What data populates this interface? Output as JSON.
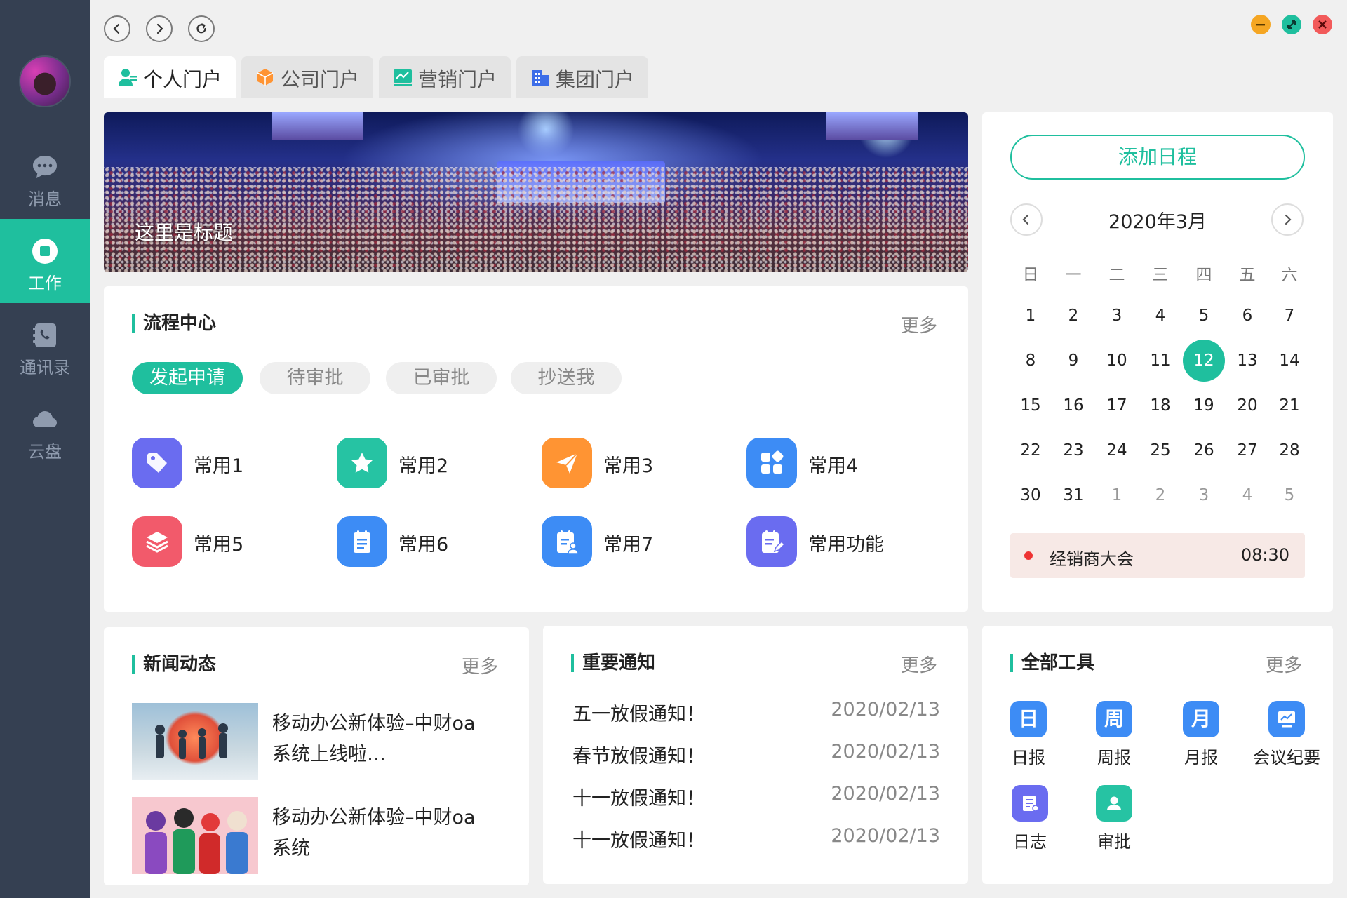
{
  "sidebar": {
    "items": [
      {
        "label": "消息",
        "icon": "message-icon"
      },
      {
        "label": "工作",
        "icon": "work-icon"
      },
      {
        "label": "通讯录",
        "icon": "phonebook-icon"
      },
      {
        "label": "云盘",
        "icon": "cloud-icon"
      }
    ],
    "active_index": 1
  },
  "tabs": [
    {
      "label": "个人门户",
      "icon": "person-icon"
    },
    {
      "label": "公司门户",
      "icon": "box-icon"
    },
    {
      "label": "营销门户",
      "icon": "chart-icon"
    },
    {
      "label": "集团门户",
      "icon": "building-icon"
    }
  ],
  "banner": {
    "title": "这里是标题"
  },
  "process": {
    "title": "流程中心",
    "more": "更多",
    "pills": [
      "发起申请",
      "待审批",
      "已审批",
      "抄送我"
    ],
    "apps": [
      {
        "label": "常用1",
        "color": "#6a6cf0"
      },
      {
        "label": "常用2",
        "color": "#26c3a3"
      },
      {
        "label": "常用3",
        "color": "#ff9433"
      },
      {
        "label": "常用4",
        "color": "#3d8cf5"
      },
      {
        "label": "常用5",
        "color": "#f25a6b"
      },
      {
        "label": "常用6",
        "color": "#3d8cf5"
      },
      {
        "label": "常用7",
        "color": "#3d8cf5"
      },
      {
        "label": "常用功能",
        "color": "#6a6cf0"
      }
    ]
  },
  "calendar": {
    "add_button": "添加日程",
    "month": "2020年3月",
    "weekdays": [
      "日",
      "一",
      "二",
      "三",
      "四",
      "五",
      "六"
    ],
    "days": [
      [
        "1",
        "2",
        "3",
        "4",
        "5",
        "6",
        "7"
      ],
      [
        "8",
        "9",
        "10",
        "11",
        "12",
        "13",
        "14"
      ],
      [
        "15",
        "16",
        "17",
        "18",
        "19",
        "20",
        "21"
      ],
      [
        "22",
        "23",
        "24",
        "25",
        "26",
        "27",
        "28"
      ],
      [
        "30",
        "31",
        "1",
        "2",
        "3",
        "4",
        "5"
      ]
    ],
    "today": "12",
    "event": {
      "title": "经销商大会",
      "time": "08:30"
    }
  },
  "news": {
    "title": "新闻动态",
    "more": "更多",
    "items": [
      {
        "line1": "移动办公新体验–中财oa",
        "line2": "系统上线啦…"
      },
      {
        "line1": "移动办公新体验–中财oa",
        "line2": "系统"
      }
    ]
  },
  "notice": {
    "title": "重要通知",
    "more": "更多",
    "items": [
      {
        "title": "五一放假通知！",
        "date": "2020/02/13"
      },
      {
        "title": "春节放假通知！",
        "date": "2020/02/13"
      },
      {
        "title": "十一放假通知！",
        "date": "2020/02/13"
      },
      {
        "title": "十一放假通知！",
        "date": "2020/02/13"
      }
    ]
  },
  "tools": {
    "title": "全部工具",
    "more": "更多",
    "items": [
      {
        "glyph": "日",
        "label": "日报",
        "color": "#3d8cf5"
      },
      {
        "glyph": "周",
        "label": "周报",
        "color": "#3d8cf5"
      },
      {
        "glyph": "月",
        "label": "月报",
        "color": "#3d8cf5"
      },
      {
        "glyph": "",
        "label": "会议纪要",
        "color": "#3d8cf5"
      },
      {
        "glyph": "",
        "label": "日志",
        "color": "#6a6cf0"
      },
      {
        "glyph": "",
        "label": "审批",
        "color": "#26c3a3"
      }
    ]
  },
  "colors": {
    "accent": "#1fbf9e",
    "sidebar": "#354052",
    "minimize": "#f5a623",
    "maximize": "#1fbf9e",
    "close": "#f25a5a"
  }
}
